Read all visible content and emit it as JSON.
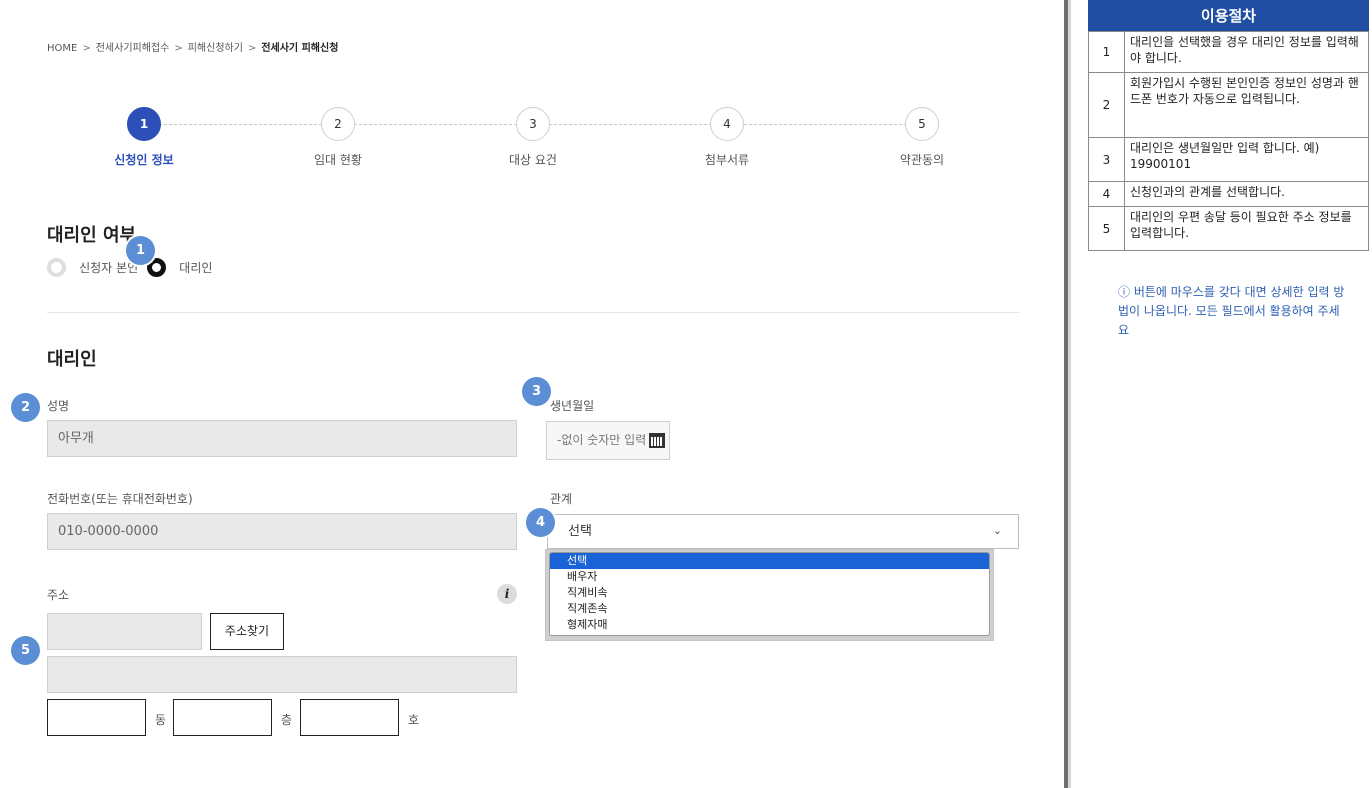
{
  "breadcrumb": {
    "items": [
      "HOME",
      "전세사기피해접수",
      "피해신청하기"
    ],
    "current": "전세사기 피해신청",
    "separator": ">"
  },
  "steps": [
    {
      "num": "1",
      "label": "신청인 정보"
    },
    {
      "num": "2",
      "label": "임대 현황"
    },
    {
      "num": "3",
      "label": "대상 요건"
    },
    {
      "num": "4",
      "label": "첨부서류"
    },
    {
      "num": "5",
      "label": "약관동의"
    }
  ],
  "proxy_section": {
    "title": "대리인 여부",
    "options": [
      "신청자 본인",
      "대리인"
    ],
    "selected": "대리인"
  },
  "agent_section": {
    "title": "대리인",
    "name": {
      "label": "성명",
      "value": "아무개"
    },
    "birth": {
      "label": "생년월일",
      "placeholder": "-없이 숫자만 입력"
    },
    "phone": {
      "label": "전화번호(또는 휴대전화번호)",
      "value": "010-0000-0000"
    },
    "relation": {
      "label": "관계",
      "value": "선택",
      "options": [
        "선택",
        "배우자",
        "직계비속",
        "직계존속",
        "형제자매"
      ]
    },
    "address": {
      "label": "주소",
      "search_button": "주소찾기",
      "info_icon": "i",
      "dong_label": "동",
      "floor_label": "층",
      "ho_label": "호"
    }
  },
  "badges": [
    "1",
    "2",
    "3",
    "4",
    "5"
  ],
  "side_panel": {
    "title": "이용절차",
    "rows": [
      {
        "num": "1",
        "text": "대리인을 선택했을 경우 대리인 정보를 입력해야 합니다."
      },
      {
        "num": "2",
        "text": "회원가입시 수행된 본인인증 정보인 성명과 핸드폰 번호가 자동으로 입력됩니다."
      },
      {
        "num": "3",
        "text": "대리인은 생년월일만 입력 합니다. 예) 19900101"
      },
      {
        "num": "4",
        "text": "신청인과의 관계를 선택합니다."
      },
      {
        "num": "5",
        "text": "대리인의 우편 송달 등이 필요한 주소 정보를 입력합니다."
      }
    ],
    "tip": "ⓘ 버튼에 마우스를 갖다 대면 상세한 입력 방법이 나옵니다. 모든 필드에서 활용하여 주세요"
  },
  "colors": {
    "accent": "#2d4fb8",
    "badge": "#5b8ed4",
    "panel_header": "#1f4ea3",
    "dropdown_selected": "#1a63d6"
  }
}
